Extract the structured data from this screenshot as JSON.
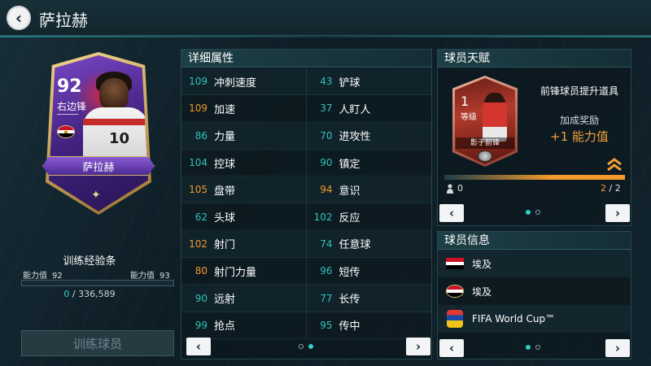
{
  "header": {
    "back_icon": "‹",
    "title": "萨拉赫"
  },
  "player_card": {
    "rating": "92",
    "position": "右边锋",
    "name": "萨拉赫",
    "jersey_number": "10"
  },
  "training": {
    "label": "训练经验条",
    "ability_left_label": "能力值",
    "ability_left_value": "92",
    "ability_right_label": "能力值",
    "ability_right_value": "93",
    "progress_fraction": 0,
    "xp_current": "0",
    "xp_separator": " / ",
    "xp_total": "336,589",
    "button_label": "训练球员"
  },
  "stats": {
    "title": "详细属性",
    "rows": [
      {
        "left_value": "109",
        "left_name": "冲刺速度",
        "left_color": "#2fc4bb",
        "right_value": "43",
        "right_name": "铲球",
        "right_color": "#2fc4bb"
      },
      {
        "left_value": "109",
        "left_name": "加速",
        "left_color": "#f09a2c",
        "right_value": "37",
        "right_name": "人盯人",
        "right_color": "#2fc4bb"
      },
      {
        "left_value": "86",
        "left_name": "力量",
        "left_color": "#2fc4bb",
        "right_value": "70",
        "right_name": "进攻性",
        "right_color": "#2fc4bb"
      },
      {
        "left_value": "104",
        "left_name": "控球",
        "left_color": "#2fc4bb",
        "right_value": "90",
        "right_name": "镇定",
        "right_color": "#2fc4bb"
      },
      {
        "left_value": "105",
        "left_name": "盘带",
        "left_color": "#f09a2c",
        "right_value": "94",
        "right_name": "意识",
        "right_color": "#f09a2c"
      },
      {
        "left_value": "62",
        "left_name": "头球",
        "left_color": "#2fc4bb",
        "right_value": "102",
        "right_name": "反应",
        "right_color": "#2fc4bb"
      },
      {
        "left_value": "102",
        "left_name": "射门",
        "left_color": "#f09a2c",
        "right_value": "74",
        "right_name": "任意球",
        "right_color": "#2fc4bb"
      },
      {
        "left_value": "80",
        "left_name": "射门力量",
        "left_color": "#f09a2c",
        "right_value": "96",
        "right_name": "短传",
        "right_color": "#2fc4bb"
      },
      {
        "left_value": "90",
        "left_name": "远射",
        "left_color": "#2fc4bb",
        "right_value": "77",
        "right_name": "长传",
        "right_color": "#2fc4bb"
      },
      {
        "left_value": "99",
        "left_name": "抢点",
        "left_color": "#2fc4bb",
        "right_value": "95",
        "right_name": "传中",
        "right_color": "#2fc4bb"
      }
    ],
    "prev_icon": "‹",
    "next_icon": "›",
    "page_dots": [
      false,
      true
    ]
  },
  "talent": {
    "title": "球员天赋",
    "card_level": "1",
    "card_level_label": "等级",
    "card_name": "影子前锋",
    "name": "前锋球员提升道具",
    "reward_label": "加成奖励",
    "reward_value": "+1 能力值",
    "count_left": "0",
    "count_current": "2",
    "count_separator": " / ",
    "count_total": "2",
    "progress_fraction": 1,
    "prev_icon": "‹",
    "next_icon": "›",
    "page_dots": [
      true,
      false
    ]
  },
  "info": {
    "title": "球员信息",
    "rows": [
      {
        "icon": "egypt-flag-icon",
        "text": "埃及"
      },
      {
        "icon": "egypt-round-flag-icon",
        "text": "埃及"
      },
      {
        "icon": "world-cup-logo-icon",
        "text": "FIFA World Cup™"
      }
    ],
    "prev_icon": "‹",
    "next_icon": "›",
    "page_dots": [
      true,
      false
    ]
  },
  "colors": {
    "accent_teal": "#2fc4bb",
    "accent_orange": "#f09a2c",
    "card_purple": "#5a2fa0"
  }
}
